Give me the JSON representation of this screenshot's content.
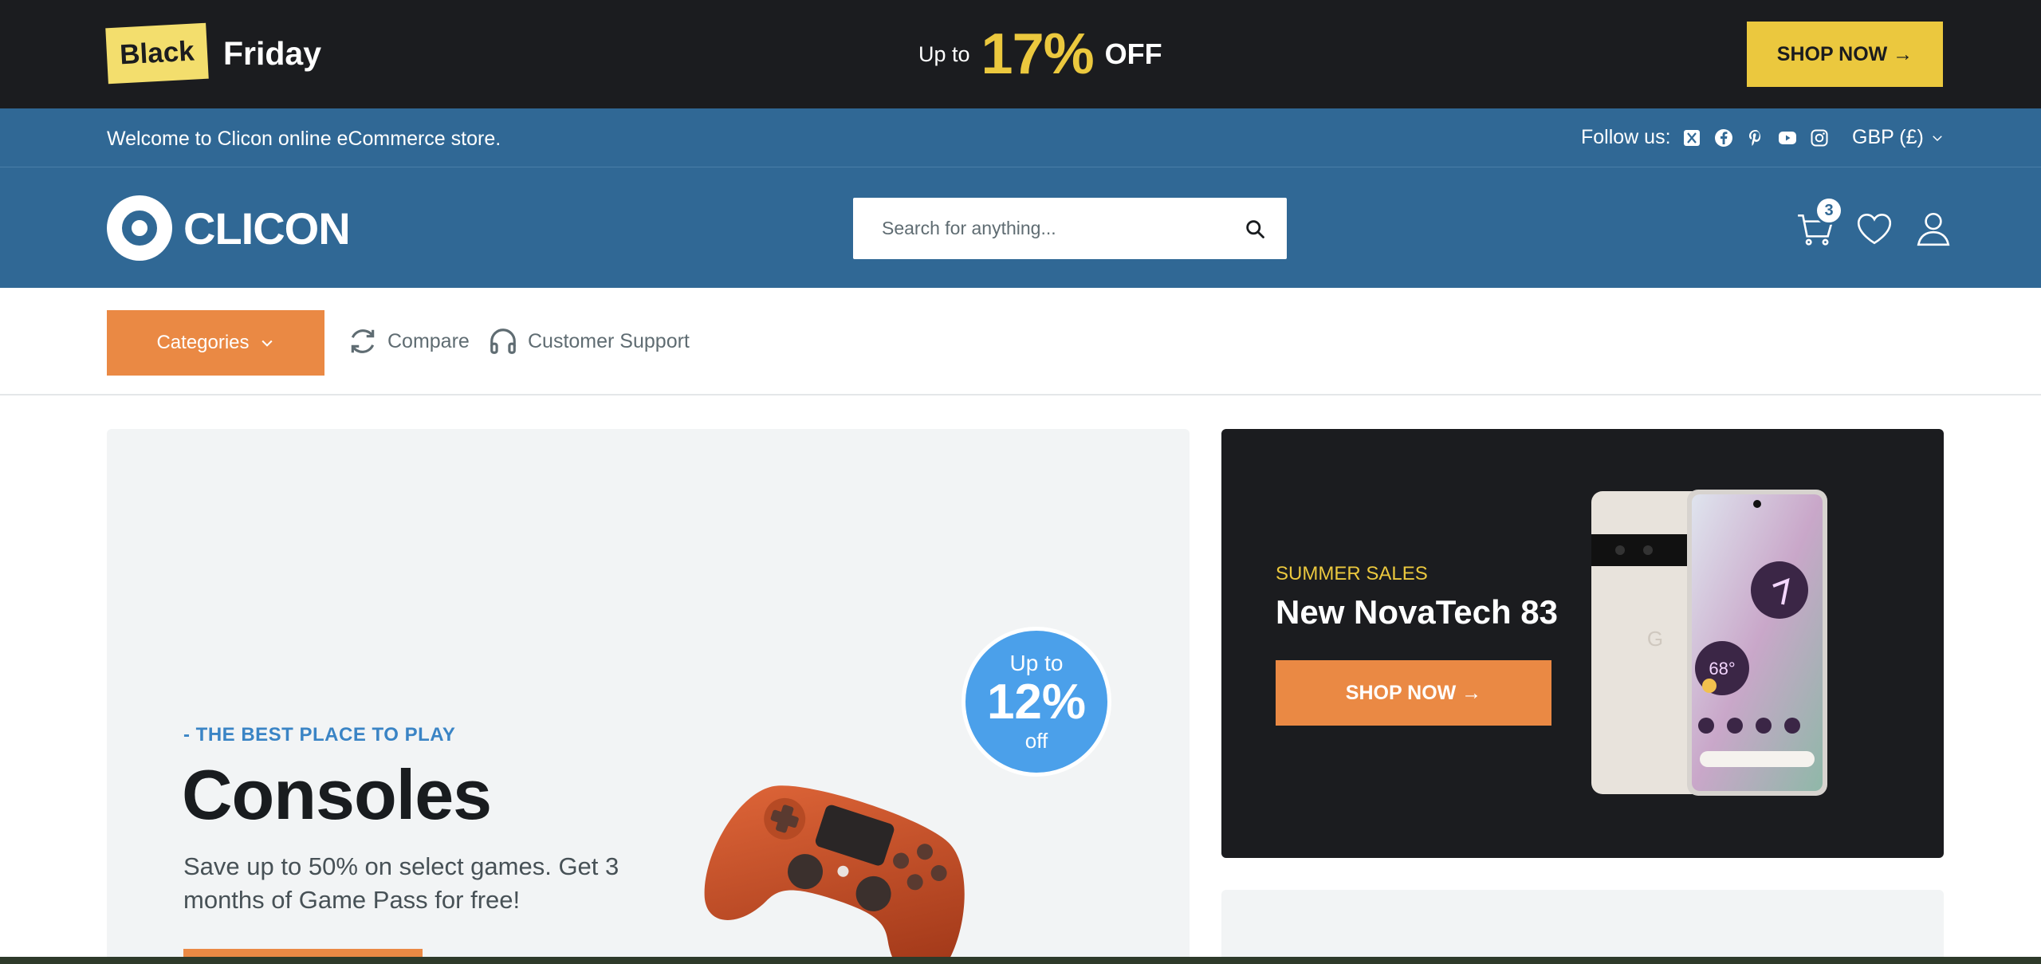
{
  "promo_bar": {
    "tag": "Black",
    "tag_suffix": "Friday",
    "up_to": "Up to",
    "percent": "17%",
    "off": "OFF",
    "button_label": "SHOP NOW →"
  },
  "welcome_bar": {
    "message": "Welcome to Clicon online eCommerce store.",
    "follow_label": "Follow us:",
    "social_icons": [
      "x-icon",
      "facebook-icon",
      "pinterest-icon",
      "youtube-icon",
      "instagram-icon"
    ],
    "currency": "GBP (£)"
  },
  "header": {
    "logo_text": "CLICON",
    "search_placeholder": "Search for anything...",
    "cart_count": "3"
  },
  "navbar": {
    "categories_label": "Categories",
    "compare_label": "Compare",
    "support_label": "Customer Support"
  },
  "hero": {
    "eyebrow": "- THE BEST PLACE TO PLAY",
    "title": "Consoles",
    "description": "Save up to 50% on select games. Get 3 months of Game Pass for free!",
    "bubble_up_to": "Up to",
    "bubble_percent": "12%",
    "bubble_off": "off"
  },
  "summer_promo": {
    "eyebrow": "SUMMER SALES",
    "title": "New NovaTech 83",
    "button_label": "SHOP NOW →"
  },
  "colors": {
    "dark": "#1b1c1f",
    "brand_blue": "#306895",
    "accent_yellow": "#ebc83e",
    "accent_orange": "#ea8944",
    "bubble_blue": "#4ba0ea",
    "hero_bg": "#f2f4f5"
  }
}
